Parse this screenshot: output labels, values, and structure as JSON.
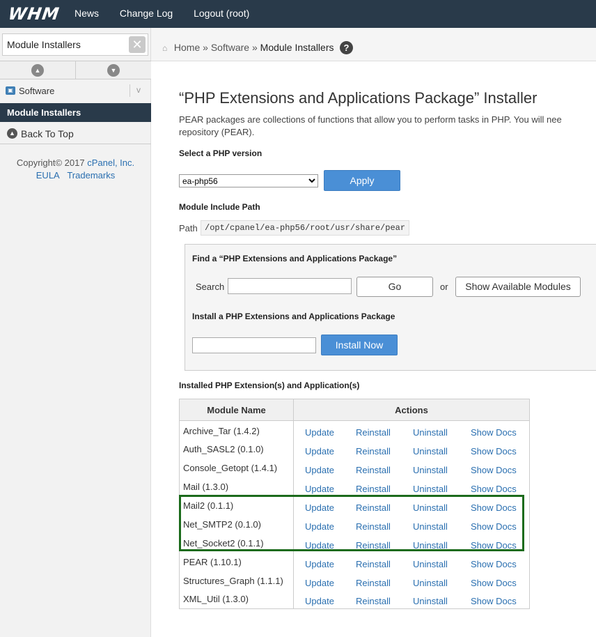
{
  "topbar": {
    "logo": "WHM",
    "nav": [
      "News",
      "Change Log",
      "Logout (root)"
    ]
  },
  "sidebar": {
    "search_value": "Module Installers",
    "category": "Software",
    "category_toggle": "v",
    "current_item": "Module Installers",
    "back_to_top": "Back To Top",
    "copyright_prefix": "Copyright© 2017 ",
    "copyright_link": "cPanel, Inc.",
    "links": [
      "EULA",
      "Trademarks"
    ]
  },
  "breadcrumb": {
    "home": "Home",
    "sep": "»",
    "software": "Software",
    "current": "Module Installers"
  },
  "main": {
    "title": "“PHP Extensions and Applications Package” Installer",
    "description_line1": "PEAR packages are collections of functions that allow you to perform tasks in PHP. You will nee",
    "description_line2": "repository (PEAR).",
    "select_php_label": "Select a PHP version",
    "php_version_selected": "ea-php56",
    "apply_label": "Apply",
    "include_path_label": "Module Include Path",
    "path_label": "Path",
    "path_value": "/opt/cpanel/ea-php56/root/usr/share/pear",
    "find_label": "Find a “PHP Extensions and Applications Package”",
    "search_label": "Search",
    "go_label": "Go",
    "or_label": "or",
    "show_modules_label": "Show Available Modules",
    "install_label": "Install a PHP Extensions and Applications Package",
    "install_now_label": "Install Now",
    "installed_label": "Installed PHP Extension(s) and Application(s)"
  },
  "table": {
    "headers": [
      "Module Name",
      "Actions"
    ],
    "actions": [
      "Update",
      "Reinstall",
      "Uninstall",
      "Show Docs"
    ],
    "rows": [
      "Archive_Tar (1.4.2)",
      "Auth_SASL2 (0.1.0)",
      "Console_Getopt (1.4.1)",
      "Mail (1.3.0)",
      "Mail2 (0.1.1)",
      "Net_SMTP2 (0.1.0)",
      "Net_Socket2 (0.1.1)",
      "PEAR (1.10.1)",
      "Structures_Graph (1.1.1)",
      "XML_Util (1.3.0)"
    ]
  },
  "colors": {
    "topbar": "#293a4a",
    "link": "#2a6fb0",
    "button": "#4a8fd6",
    "highlight": "#1c6b1c"
  }
}
